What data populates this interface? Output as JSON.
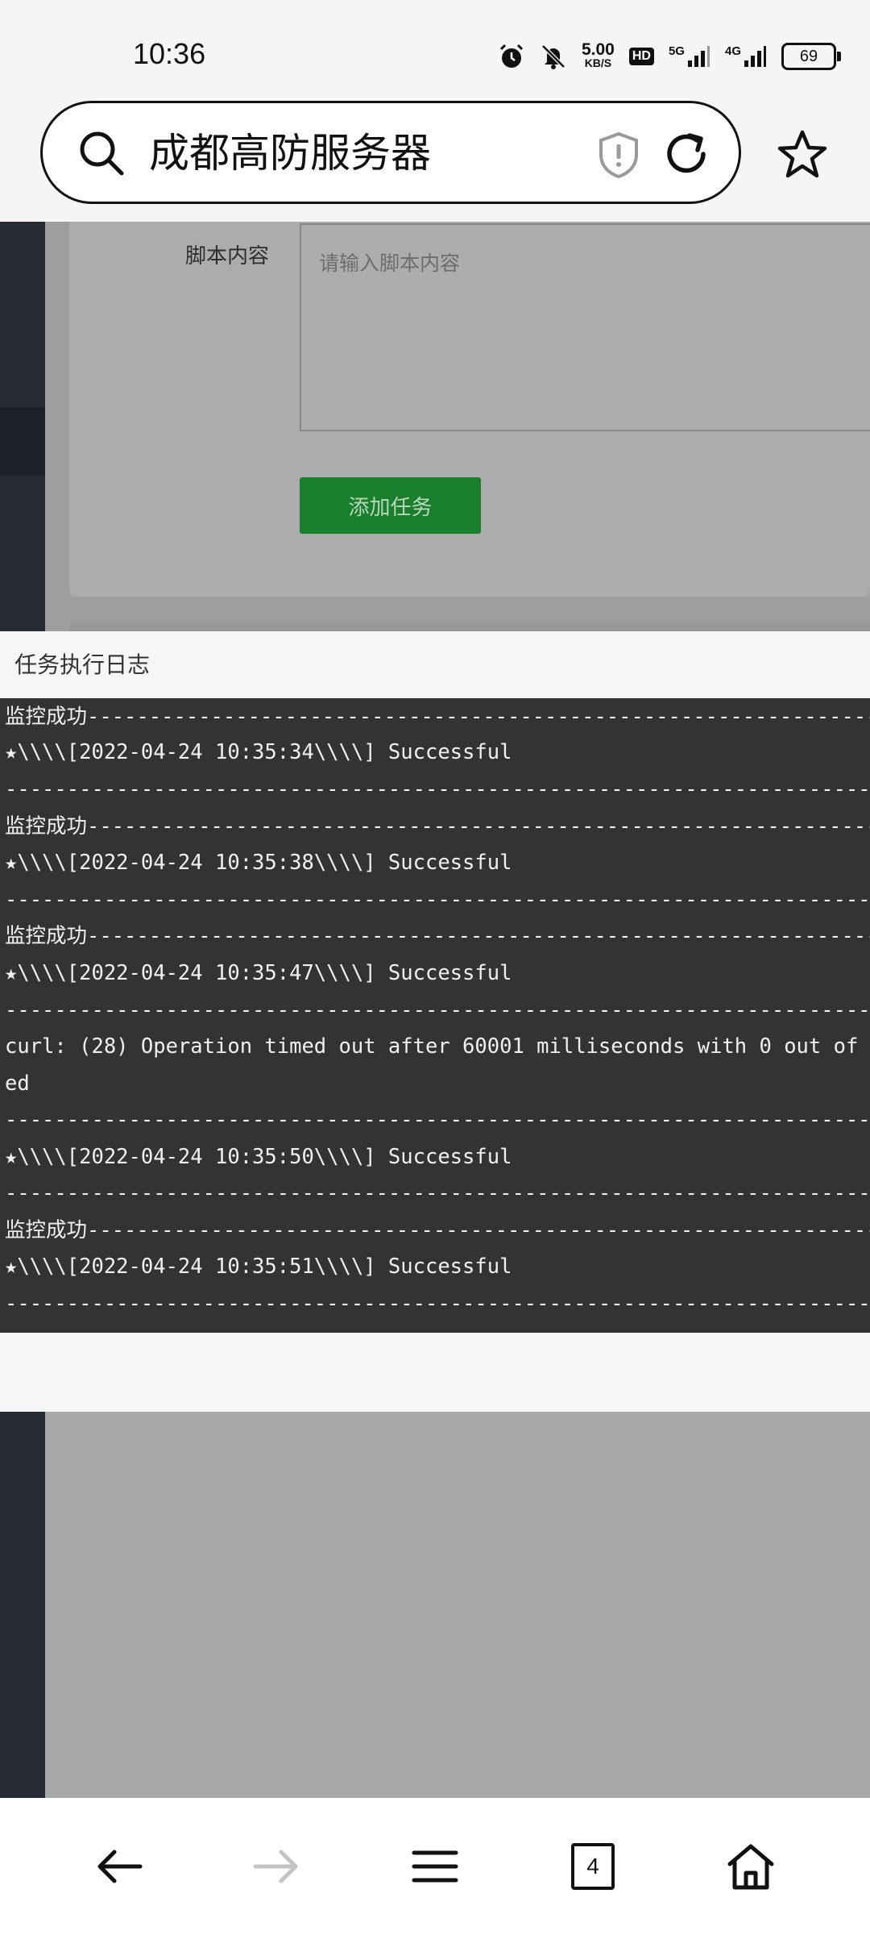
{
  "status_bar": {
    "time": "10:36",
    "net_speed_value": "5.00",
    "net_speed_unit": "KB/S",
    "hd_badge": "HD",
    "signal1_label": "5G",
    "signal2_label": "4G",
    "battery": "69",
    "icons": [
      "alarm-icon",
      "mute-icon",
      "hd-icon",
      "signal-5g-icon",
      "signal-4g-icon",
      "battery-icon"
    ]
  },
  "address_bar": {
    "text": "成都高防服务器",
    "icons": [
      "search-icon",
      "shield-icon",
      "reload-icon",
      "star-icon"
    ]
  },
  "form": {
    "script_label": "脚本内容",
    "script_placeholder": "请输入脚本内容",
    "add_task_label": "添加任务",
    "button_color": "#1a7f2c"
  },
  "log": {
    "title": "任务执行日志",
    "background": "#333333",
    "lines": [
      "监控成功--------------------------------------------------------------------------",
      "★\\\\\\\\[2022-04-24 10:35:34\\\\\\\\] Successful",
      "----------------------------------------------------------------------------------",
      "监控成功--------------------------------------------------------------------------",
      "★\\\\\\\\[2022-04-24 10:35:38\\\\\\\\] Successful",
      "----------------------------------------------------------------------------------",
      "监控成功--------------------------------------------------------------------------",
      "★\\\\\\\\[2022-04-24 10:35:47\\\\\\\\] Successful",
      "----------------------------------------------------------------------------------",
      "curl: (28) Operation timed out after 60001 milliseconds with 0 out of",
      "ed",
      "----------------------------------------------------------------------------------",
      "★\\\\\\\\[2022-04-24 10:35:50\\\\\\\\] Successful",
      "----------------------------------------------------------------------------------",
      "监控成功--------------------------------------------------------------------------",
      "★\\\\\\\\[2022-04-24 10:35:51\\\\\\\\] Successful",
      "----------------------------------------------------------------------------------"
    ]
  },
  "nav": {
    "tab_count": "4",
    "icons": [
      "back-arrow-icon",
      "forward-arrow-icon",
      "menu-icon",
      "tabs-icon",
      "home-icon"
    ]
  }
}
